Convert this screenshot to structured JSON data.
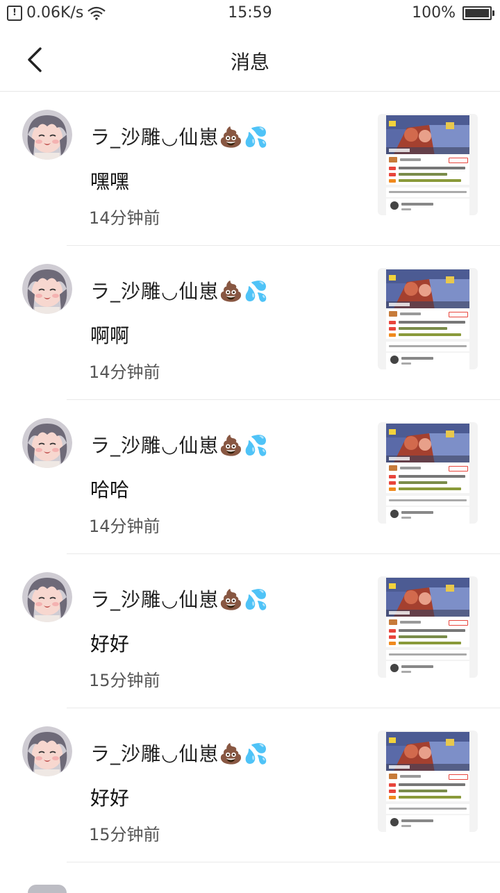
{
  "status_bar": {
    "network_speed": "0.06K/s",
    "time": "15:59",
    "battery": "100%"
  },
  "header": {
    "title": "消息"
  },
  "messages": [
    {
      "sender": "ラ_沙雕◡仙崽💩💦",
      "text": "嘿嘿",
      "time": "14分钟前"
    },
    {
      "sender": "ラ_沙雕◡仙崽💩💦",
      "text": "啊啊",
      "time": "14分钟前"
    },
    {
      "sender": "ラ_沙雕◡仙崽💩💦",
      "text": "哈哈",
      "time": "14分钟前"
    },
    {
      "sender": "ラ_沙雕◡仙崽💩💦",
      "text": "好好",
      "time": "15分钟前"
    },
    {
      "sender": "ラ_沙雕◡仙崽💩💦",
      "text": "好好",
      "time": "15分钟前"
    }
  ],
  "colors": {
    "divider": "#e9e9e9",
    "thumb_bg": "#f3f3f3",
    "accent_red": "#e8453c"
  },
  "icons": {
    "back": "chevron-left-icon",
    "wifi": "wifi-icon",
    "battery": "battery-icon",
    "alert": "alert-icon"
  }
}
